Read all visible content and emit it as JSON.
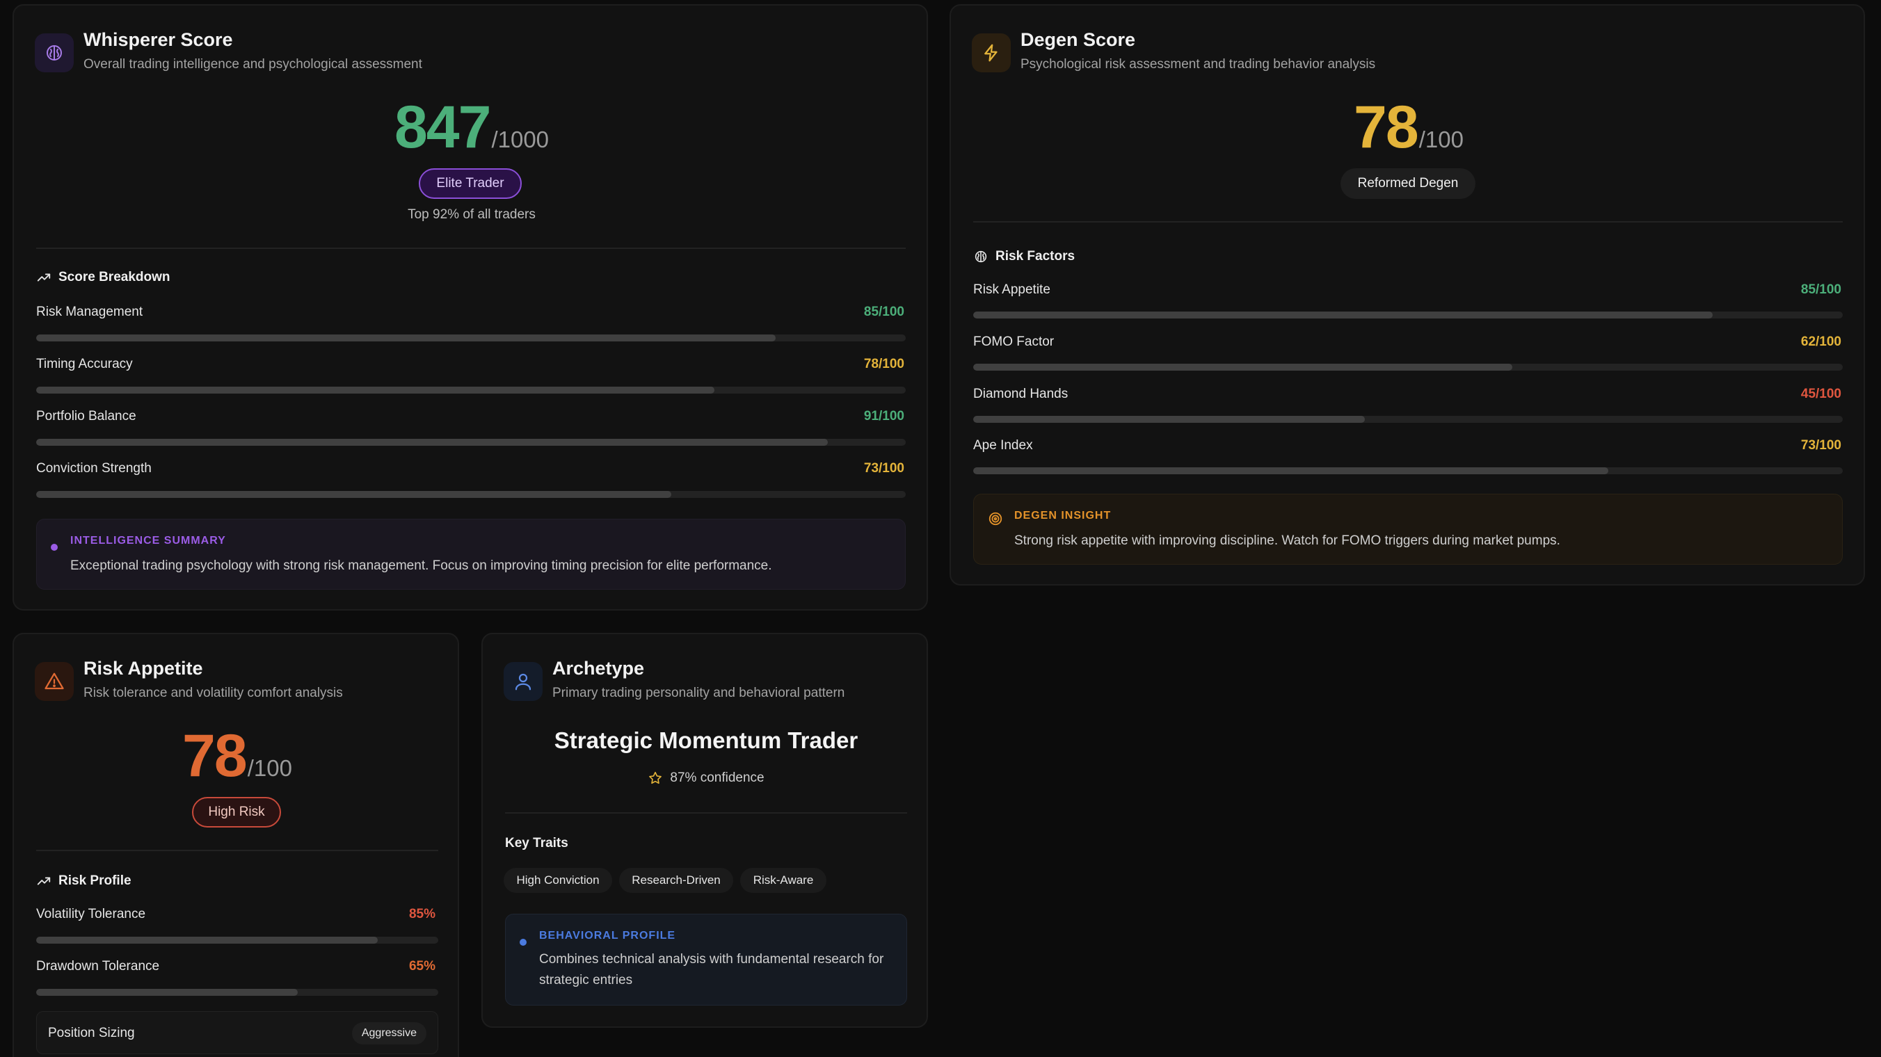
{
  "colors": {
    "green": "#4caf7a",
    "yellow": "#e4b43a",
    "red": "#e0563f",
    "orange": "#e06a33",
    "purple": "#9b5ce6",
    "blue": "#4b7be0"
  },
  "whisperer": {
    "icon": "brain-icon",
    "title": "Whisperer Score",
    "subtitle": "Overall trading intelligence and psychological assessment",
    "score": "847",
    "denominator": "/1000",
    "badge": "Elite Trader",
    "rank_text": "Top 92% of all traders",
    "breakdown_title": "Score Breakdown",
    "metrics": [
      {
        "label": "Risk Management",
        "value_text": "85/100",
        "fraction": 0.85
      },
      {
        "label": "Timing Accuracy",
        "value_text": "78/100",
        "fraction": 0.78
      },
      {
        "label": "Portfolio Balance",
        "value_text": "91/100",
        "fraction": 0.91
      },
      {
        "label": "Conviction Strength",
        "value_text": "73/100",
        "fraction": 0.73
      }
    ],
    "summary_tag": "INTELLIGENCE SUMMARY",
    "summary_text": "Exceptional trading psychology with strong risk management. Focus on improving timing precision for elite performance."
  },
  "degen": {
    "icon": "lightning-icon",
    "title": "Degen Score",
    "subtitle": "Psychological risk assessment and trading behavior analysis",
    "score": "78",
    "denominator": "/100",
    "badge": "Reformed Degen",
    "factors_title": "Risk Factors",
    "metrics": [
      {
        "label": "Risk Appetite",
        "value_text": "85/100",
        "fraction": 0.85
      },
      {
        "label": "FOMO Factor",
        "value_text": "62/100",
        "fraction": 0.62
      },
      {
        "label": "Diamond Hands",
        "value_text": "45/100",
        "fraction": 0.45
      },
      {
        "label": "Ape Index",
        "value_text": "73/100",
        "fraction": 0.73
      }
    ],
    "insight_tag": "DEGEN INSIGHT",
    "insight_text": "Strong risk appetite with improving discipline. Watch for FOMO triggers during market pumps."
  },
  "risk": {
    "icon": "warning-icon",
    "title": "Risk Appetite",
    "subtitle": "Risk tolerance and volatility comfort analysis",
    "score": "78",
    "denominator": "/100",
    "badge": "High Risk",
    "profile_title": "Risk Profile",
    "metrics": [
      {
        "label": "Volatility Tolerance",
        "value_text": "85%",
        "fraction": 0.85
      },
      {
        "label": "Drawdown Tolerance",
        "value_text": "65%",
        "fraction": 0.65
      }
    ],
    "position_label": "Position Sizing",
    "position_value": "Aggressive"
  },
  "archetype": {
    "icon": "user-icon",
    "title": "Archetype",
    "subtitle": "Primary trading personality and behavioral pattern",
    "name": "Strategic Momentum Trader",
    "confidence": "87% confidence",
    "traits_title": "Key Traits",
    "traits": [
      "High Conviction",
      "Research-Driven",
      "Risk-Aware"
    ],
    "profile_tag": "BEHAVIORAL PROFILE",
    "profile_text": "Combines technical analysis with fundamental research for strategic entries"
  }
}
